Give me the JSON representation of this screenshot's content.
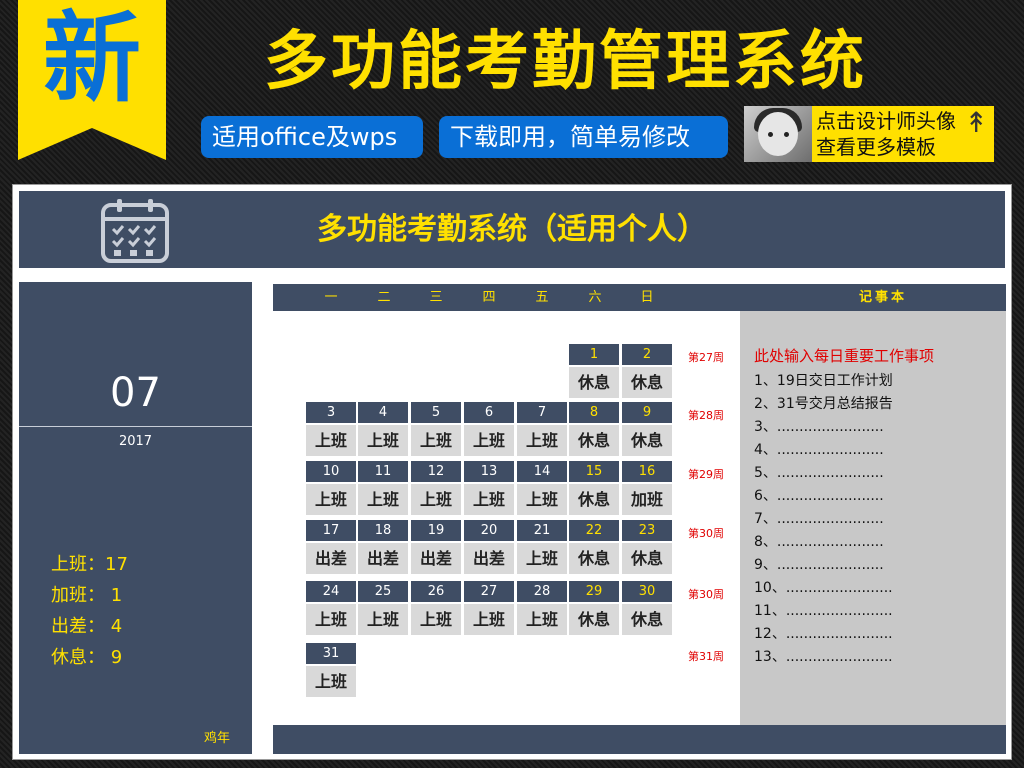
{
  "banner": {
    "char": "新"
  },
  "main_title": "多功能考勤管理系统",
  "pills": [
    "适用office及wps",
    "下载即用，简单易修改"
  ],
  "promo": {
    "line1": "点击设计师头像",
    "line2": "查看更多模板"
  },
  "app": {
    "title": "多功能考勤系统（适用个人）",
    "icon": "calendar-icon",
    "month": "07",
    "year": "2017",
    "zodiac": "鸡年",
    "stats": [
      {
        "label": "上班：",
        "value": "17"
      },
      {
        "label": "加班：",
        "value": "1"
      },
      {
        "label": "出差：",
        "value": "4"
      },
      {
        "label": "休息：",
        "value": "9"
      }
    ],
    "weekdays": [
      "一",
      "二",
      "三",
      "四",
      "五",
      "六",
      "日"
    ],
    "memo_title": "记事本",
    "weeks": [
      "第27周",
      "第28周",
      "第29周",
      "第30周",
      "第30周",
      "第31周"
    ],
    "days": [
      {
        "n": "1",
        "s": "休息"
      },
      {
        "n": "2",
        "s": "休息"
      },
      {
        "n": "3",
        "s": "上班"
      },
      {
        "n": "4",
        "s": "上班"
      },
      {
        "n": "5",
        "s": "上班"
      },
      {
        "n": "6",
        "s": "上班"
      },
      {
        "n": "7",
        "s": "上班"
      },
      {
        "n": "8",
        "s": "休息"
      },
      {
        "n": "9",
        "s": "休息"
      },
      {
        "n": "10",
        "s": "上班"
      },
      {
        "n": "11",
        "s": "上班"
      },
      {
        "n": "12",
        "s": "上班"
      },
      {
        "n": "13",
        "s": "上班"
      },
      {
        "n": "14",
        "s": "上班"
      },
      {
        "n": "15",
        "s": "休息"
      },
      {
        "n": "16",
        "s": "加班"
      },
      {
        "n": "17",
        "s": "出差"
      },
      {
        "n": "18",
        "s": "出差"
      },
      {
        "n": "19",
        "s": "出差"
      },
      {
        "n": "20",
        "s": "出差"
      },
      {
        "n": "21",
        "s": "上班"
      },
      {
        "n": "22",
        "s": "休息"
      },
      {
        "n": "23",
        "s": "休息"
      },
      {
        "n": "24",
        "s": "上班"
      },
      {
        "n": "25",
        "s": "上班"
      },
      {
        "n": "26",
        "s": "上班"
      },
      {
        "n": "27",
        "s": "上班"
      },
      {
        "n": "28",
        "s": "上班"
      },
      {
        "n": "29",
        "s": "休息"
      },
      {
        "n": "30",
        "s": "休息"
      },
      {
        "n": "31",
        "s": "上班"
      }
    ],
    "memo": [
      "此处输入每日重要工作事项",
      "1、19日交日工作计划",
      "2、31号交月总结报告",
      "3、........................",
      "4、........................",
      "5、........................",
      "6、........................",
      "7、........................",
      "8、........................",
      "9、........................",
      "10、........................",
      "11、........................",
      "12、........................",
      "13、........................"
    ],
    "colors": {
      "panel": "#3f4d64",
      "accent": "#ffe000",
      "memo_head": "#e00000"
    }
  }
}
